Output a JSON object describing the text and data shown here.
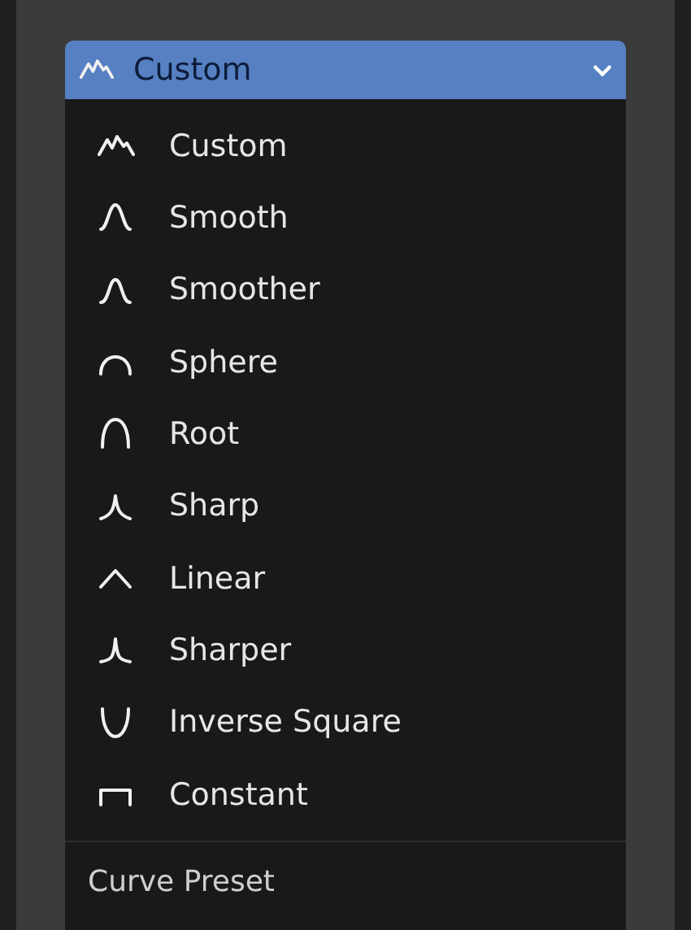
{
  "dropdown": {
    "value": "Custom",
    "kind": "custom"
  },
  "menu": {
    "items": [
      {
        "label": "Custom",
        "kind": "custom"
      },
      {
        "label": "Smooth",
        "kind": "smooth"
      },
      {
        "label": "Smoother",
        "kind": "smoother"
      },
      {
        "label": "Sphere",
        "kind": "sphere"
      },
      {
        "label": "Root",
        "kind": "root"
      },
      {
        "label": "Sharp",
        "kind": "sharp"
      },
      {
        "label": "Linear",
        "kind": "linear"
      },
      {
        "label": "Sharper",
        "kind": "sharper"
      },
      {
        "label": "Inverse Square",
        "kind": "inverse"
      },
      {
        "label": "Constant",
        "kind": "constant"
      }
    ],
    "title": "Curve Preset"
  }
}
